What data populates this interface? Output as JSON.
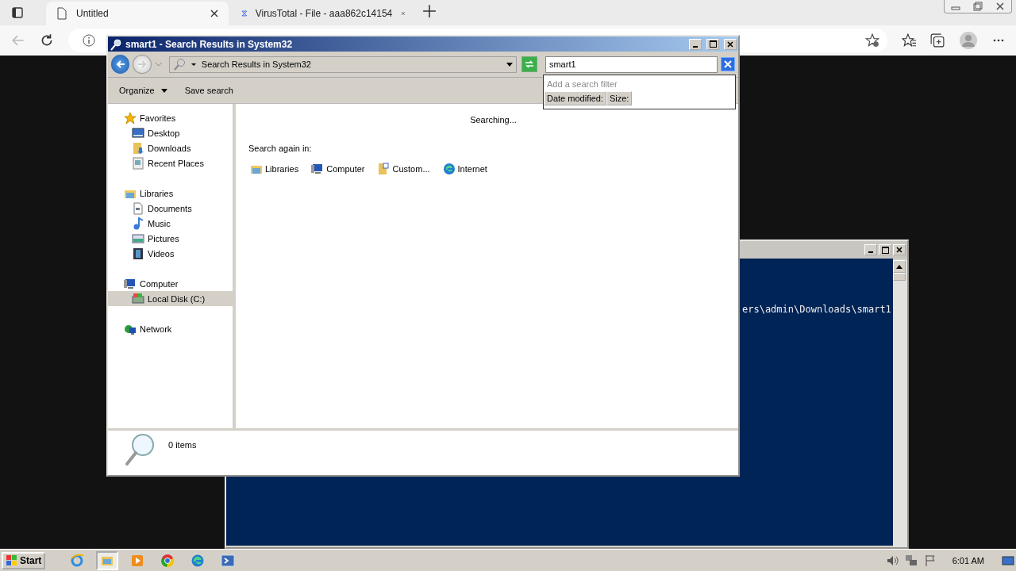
{
  "browser": {
    "tabs": [
      {
        "title": "Untitled",
        "selected": true
      },
      {
        "title": "VirusTotal - File - aaa862c14154",
        "selected": false
      }
    ]
  },
  "console": {
    "lines": [
      "ers\\admin\\Downloads\\smart1"
    ]
  },
  "explorer": {
    "title": "smart1 - Search Results in System32",
    "address": "Search Results in System32",
    "search": {
      "value": "smart1",
      "filter_placeholder": "Add a search filter",
      "filters": [
        "Date modified:",
        "Size:"
      ]
    },
    "toolbar": [
      {
        "label": "Organize",
        "dropdown": true
      },
      {
        "label": "Save search",
        "dropdown": false
      }
    ],
    "nav": [
      {
        "label": "Favorites",
        "selected": false,
        "children": [
          {
            "label": "Desktop",
            "selected": false
          },
          {
            "label": "Downloads",
            "selected": false
          },
          {
            "label": "Recent Places",
            "selected": false
          }
        ]
      },
      {
        "label": "Libraries",
        "selected": false,
        "children": [
          {
            "label": "Documents",
            "selected": false
          },
          {
            "label": "Music",
            "selected": false
          },
          {
            "label": "Pictures",
            "selected": false
          },
          {
            "label": "Videos",
            "selected": false
          }
        ]
      },
      {
        "label": "Computer",
        "selected": false,
        "children": [
          {
            "label": "Local Disk (C:)",
            "selected": true
          }
        ]
      },
      {
        "label": "Network",
        "selected": false
      }
    ],
    "status": "Searching...",
    "search_again_label": "Search again in:",
    "locations": [
      "Libraries",
      "Computer",
      "Custom...",
      "Internet"
    ],
    "details": "0 items"
  },
  "taskbar": {
    "start": "Start",
    "apps": [
      {
        "selected": false
      },
      {
        "selected": true
      },
      {
        "selected": false
      },
      {
        "selected": false
      },
      {
        "selected": false
      },
      {
        "selected": false
      }
    ],
    "clock": "6:01 AM"
  }
}
